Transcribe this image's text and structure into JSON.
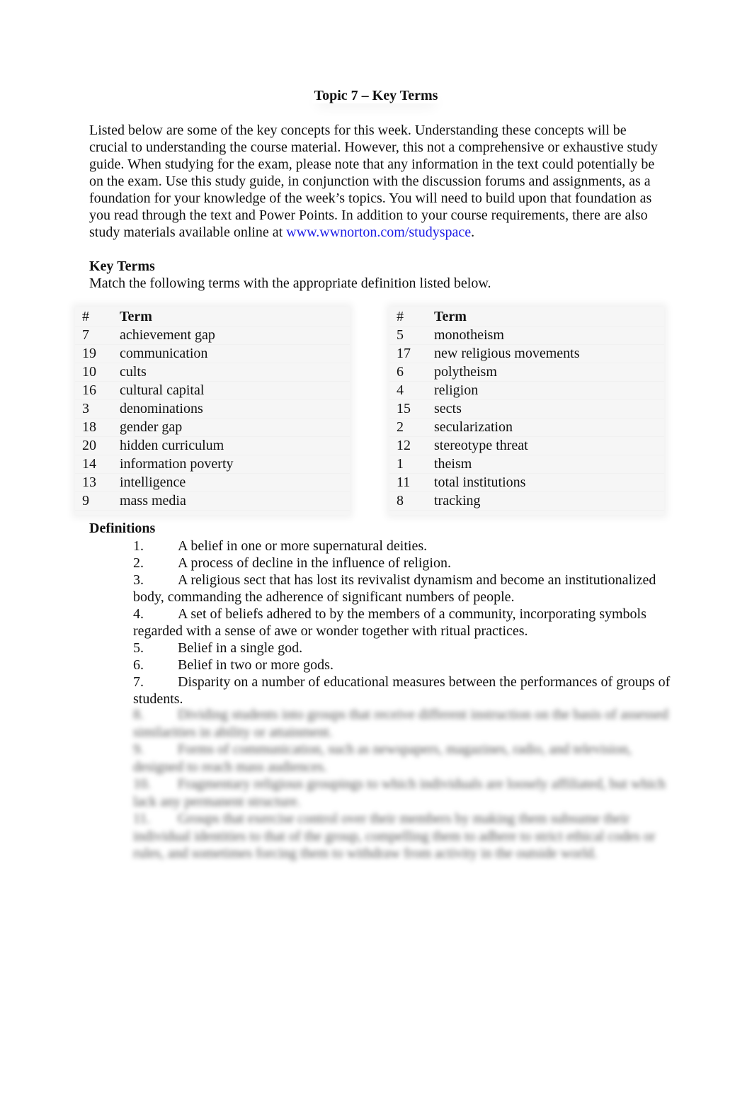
{
  "document": {
    "title": "Topic 7 – Key Terms",
    "intro_text": "Listed below are some of the key concepts for this week. Understanding these concepts will be crucial to understanding the course material. However, this not a comprehensive or exhaustive study guide. When studying for the exam, please note that any information in the text could potentially be on the exam. Use this study guide, in conjunction with the discussion forums and assignments, as a foundation for your knowledge of the week’s topics. You will need to build upon that foundation as you read through the text and Power Points. In addition to your course requirements, there are also study materials available online at ",
    "intro_link": "www.wwnorton.com/studyspace",
    "intro_end": ".",
    "link_color": "#1a1ae6",
    "key_terms_heading": "Key Terms",
    "key_terms_instruction": "Match the following terms with the appropriate definition listed below.",
    "table_headers": {
      "num": "#",
      "term": "Term"
    },
    "left_table": [
      {
        "num": "7",
        "term": "achievement gap"
      },
      {
        "num": "19",
        "term": "communication"
      },
      {
        "num": "10",
        "term": "cults"
      },
      {
        "num": "16",
        "term": "cultural capital"
      },
      {
        "num": "3",
        "term": "denominations"
      },
      {
        "num": "18",
        "term": "gender gap"
      },
      {
        "num": "20",
        "term": "hidden curriculum"
      },
      {
        "num": "14",
        "term": "information poverty"
      },
      {
        "num": "13",
        "term": "intelligence"
      },
      {
        "num": "9",
        "term": "mass media"
      }
    ],
    "right_table": [
      {
        "num": "5",
        "term": "monotheism"
      },
      {
        "num": "17",
        "term": "new religious movements"
      },
      {
        "num": "6",
        "term": "polytheism"
      },
      {
        "num": "4",
        "term": "religion"
      },
      {
        "num": "15",
        "term": "sects"
      },
      {
        "num": "2",
        "term": "secularization"
      },
      {
        "num": "12",
        "term": "stereotype threat"
      },
      {
        "num": "1",
        "term": "theism"
      },
      {
        "num": "11",
        "term": "total institutions"
      },
      {
        "num": "8",
        "term": "tracking"
      }
    ],
    "definitions_heading": "Definitions",
    "definitions": [
      {
        "n": "1.",
        "text": "A belief in one or more supernatural deities."
      },
      {
        "n": "2.",
        "text": "A process of decline in the influence of religion."
      },
      {
        "n": "3.",
        "text": "A religious sect that has lost its revivalist dynamism and become an institutionalized body, commanding the adherence of significant numbers of people."
      },
      {
        "n": "4.",
        "text": "A set of beliefs adhered to by the members of a community, incorporating symbols regarded with a sense of awe or wonder together with ritual practices."
      },
      {
        "n": "5.",
        "text": "Belief in a single god."
      },
      {
        "n": "6.",
        "text": "Belief in two or more gods."
      },
      {
        "n": "7.",
        "text": "Disparity on a number of educational measures between the performances of groups of students."
      }
    ],
    "blurred_definitions": [
      {
        "n": "8.",
        "text": "Dividing students into groups that receive different instruction on the basis of assessed similarities in ability or attainment."
      },
      {
        "n": "9.",
        "text": "Forms of communication, such as newspapers, magazines, radio, and television, designed to reach mass audiences."
      },
      {
        "n": "10.",
        "text": "Fragmentary religious groupings to which individuals are loosely affiliated, but which lack any permanent structure."
      },
      {
        "n": "11.",
        "text": "Groups that exercise control over their members by making them subsume their individual identities to that of the group, compelling them to adhere to strict ethical codes or rules, and sometimes forcing them to withdraw from activity in the outside world."
      }
    ]
  }
}
